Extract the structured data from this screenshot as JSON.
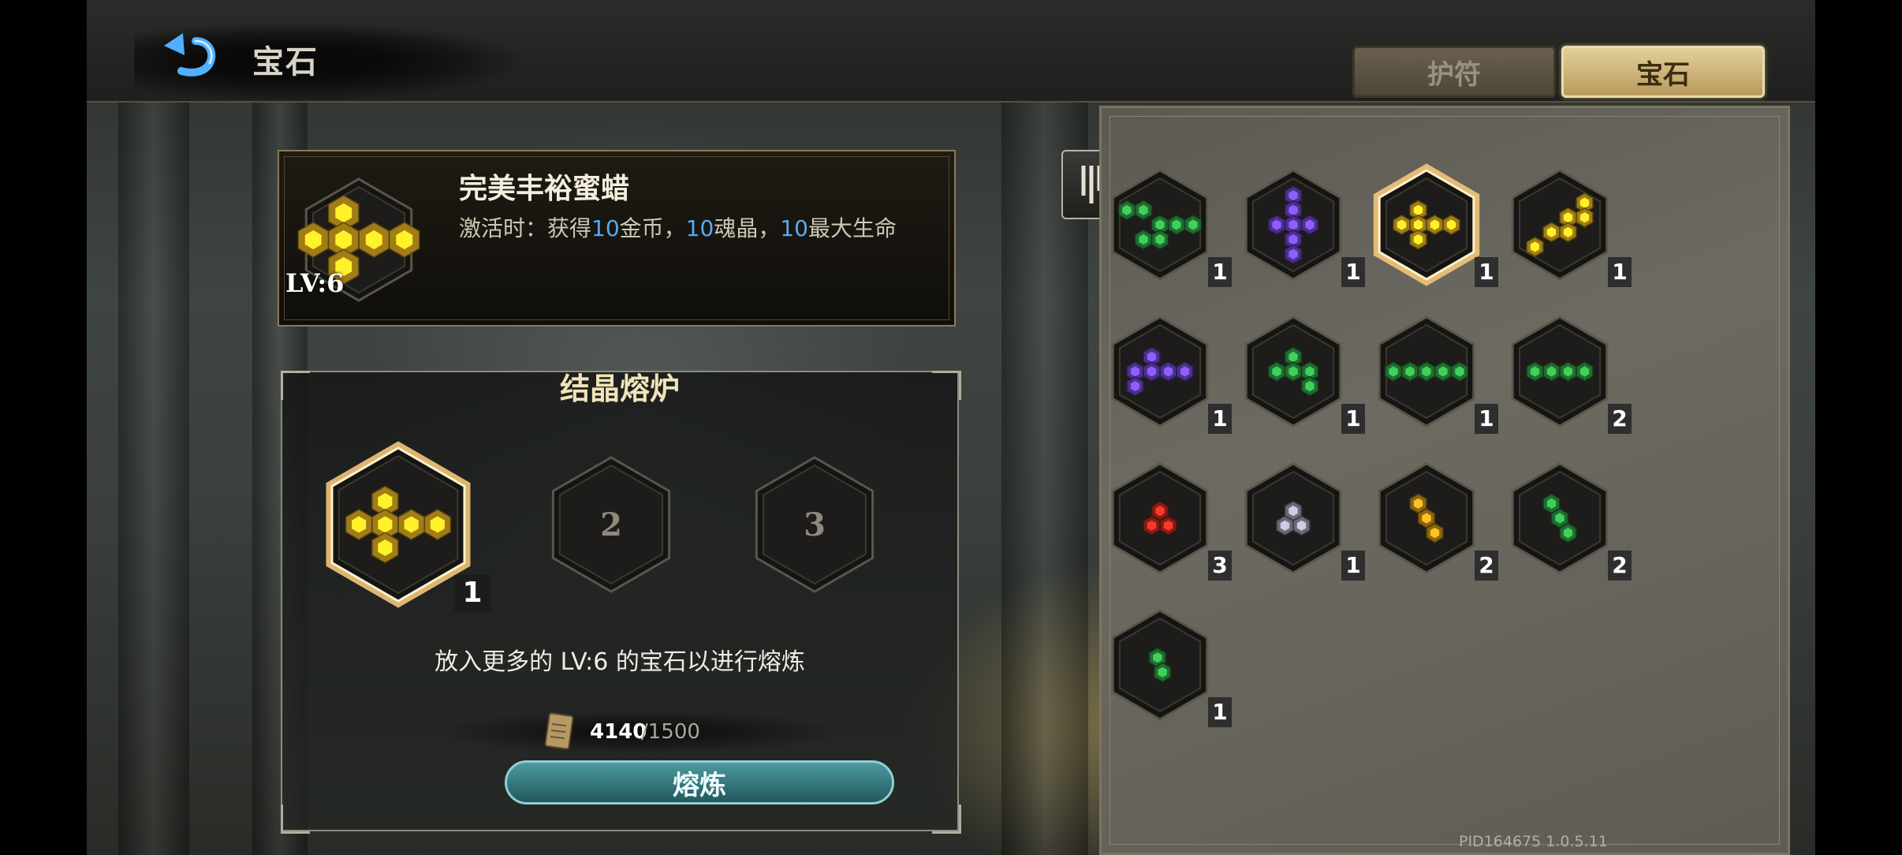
{
  "header": {
    "title": "宝石"
  },
  "tabs": [
    {
      "label": "护符",
      "selected": false
    },
    {
      "label": "宝石",
      "selected": true
    }
  ],
  "selected_gem": {
    "name": "完美丰裕蜜蜡",
    "level": "LV:6",
    "desc_parts": [
      "激活时：获得",
      "10",
      "金币，",
      "10",
      "魂晶，",
      "10",
      "最大生命"
    ],
    "color": "#e8b320",
    "shape": [
      [
        0,
        -1
      ],
      [
        -1,
        0
      ],
      [
        0,
        0
      ],
      [
        1,
        0
      ],
      [
        2,
        0
      ],
      [
        0,
        1
      ]
    ]
  },
  "furnace": {
    "title": "结晶熔炉",
    "slots": [
      {
        "filled": true,
        "count": "1",
        "color": "#e8b320",
        "shape": [
          [
            0,
            -1
          ],
          [
            -1,
            0
          ],
          [
            0,
            0
          ],
          [
            1,
            0
          ],
          [
            2,
            0
          ],
          [
            0,
            1
          ]
        ]
      },
      {
        "filled": false,
        "label": "2"
      },
      {
        "filled": false,
        "label": "3"
      }
    ],
    "hint": "放入更多的 LV:6 的宝石以进行熔炼",
    "cost_have": "4140",
    "cost_need": "/1500",
    "button_label": "熔炼"
  },
  "inventory": [
    {
      "color": "#2f9a45",
      "count": "1",
      "shape": [
        [
          -3,
          -1
        ],
        [
          -2,
          -1
        ],
        [
          -1,
          0
        ],
        [
          0,
          0
        ],
        [
          1,
          0
        ],
        [
          -2,
          1
        ],
        [
          -1,
          1
        ]
      ]
    },
    {
      "color": "#6b45c8",
      "count": "1",
      "shape": [
        [
          0,
          -2
        ],
        [
          0,
          -1
        ],
        [
          -1,
          0
        ],
        [
          0,
          0
        ],
        [
          1,
          0
        ],
        [
          0,
          1
        ],
        [
          0,
          2
        ]
      ]
    },
    {
      "color": "#e8b320",
      "count": "1",
      "shape": [
        [
          0,
          -1
        ],
        [
          -1,
          0
        ],
        [
          0,
          0
        ],
        [
          1,
          0
        ],
        [
          2,
          0
        ],
        [
          0,
          1
        ]
      ]
    },
    {
      "color": "#e8b320",
      "count": "1",
      "shape": [
        [
          0,
          -1
        ],
        [
          -1,
          0
        ],
        [
          0,
          0
        ],
        [
          -2,
          1
        ],
        [
          -1,
          1
        ],
        [
          -3,
          2
        ]
      ]
    },
    {
      "color": "#6b45c8",
      "count": "1",
      "shape": [
        [
          0,
          -1
        ],
        [
          -1,
          0
        ],
        [
          0,
          0
        ],
        [
          1,
          0
        ],
        [
          2,
          0
        ],
        [
          -1,
          1
        ]
      ]
    },
    {
      "color": "#2f9a45",
      "count": "1",
      "shape": [
        [
          0,
          -1
        ],
        [
          -1,
          0
        ],
        [
          0,
          0
        ],
        [
          1,
          0
        ],
        [
          1,
          1
        ]
      ]
    },
    {
      "color": "#2f9a45",
      "count": "1",
      "shape": [
        [
          -2,
          0
        ],
        [
          -1,
          0
        ],
        [
          0,
          0
        ],
        [
          1,
          0
        ],
        [
          2,
          0
        ]
      ]
    },
    {
      "color": "#2f9a45",
      "count": "2",
      "shape": [
        [
          -1,
          0
        ],
        [
          0,
          0
        ],
        [
          1,
          0
        ],
        [
          2,
          0
        ]
      ]
    },
    {
      "color": "#b92a20",
      "count": "3",
      "shape": [
        [
          0,
          -0.5
        ],
        [
          -0.5,
          0.5
        ],
        [
          0.5,
          0.5
        ]
      ]
    },
    {
      "color": "#9a98a8",
      "count": "1",
      "shape": [
        [
          0,
          -0.5
        ],
        [
          -0.5,
          0.5
        ],
        [
          0.5,
          0.5
        ]
      ]
    },
    {
      "color": "#c8901a",
      "count": "2",
      "shape": [
        [
          -0.5,
          -1
        ],
        [
          0,
          0
        ],
        [
          0.5,
          1
        ]
      ]
    },
    {
      "color": "#2f9a45",
      "count": "2",
      "shape": [
        [
          -0.5,
          -1
        ],
        [
          0,
          0
        ],
        [
          0.5,
          1
        ]
      ]
    },
    {
      "color": "#2f9a45",
      "count": "1",
      "shape": [
        [
          0,
          -0.5
        ],
        [
          0.3,
          0.5
        ]
      ]
    }
  ],
  "footer": {
    "pid": "PID164675  1.0.5.11"
  },
  "icons": {
    "back": "back-arrow-icon",
    "filter": "filter-icon",
    "currency": "scroll-icon"
  }
}
